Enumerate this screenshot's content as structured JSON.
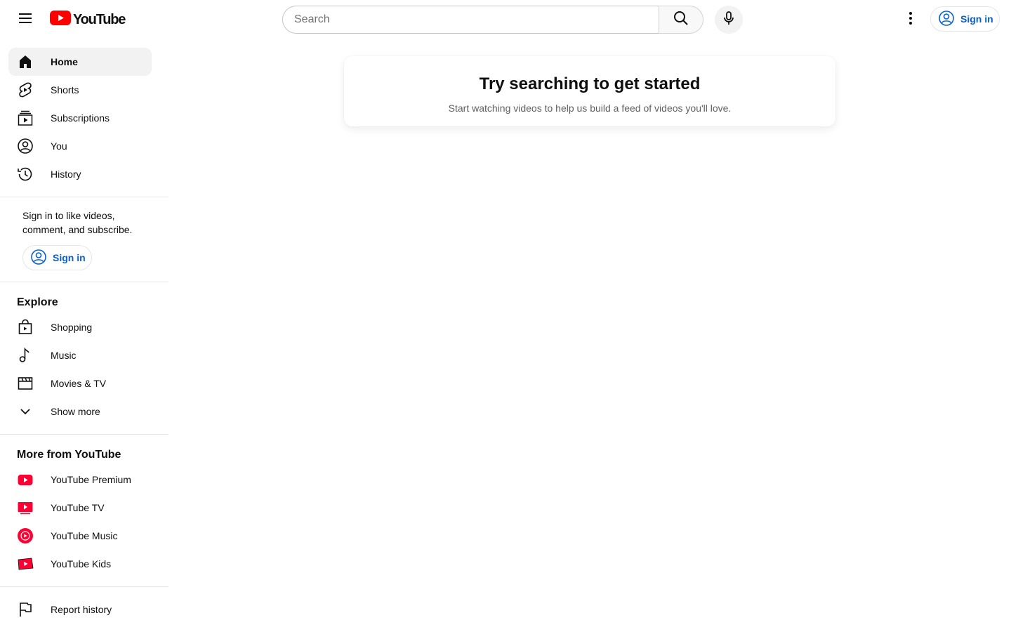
{
  "header": {
    "logo_text": "YouTube",
    "search_placeholder": "Search",
    "signin_label": "Sign in"
  },
  "sidebar": {
    "main_items": [
      {
        "label": "Home",
        "icon": "home-icon",
        "active": true
      },
      {
        "label": "Shorts",
        "icon": "shorts-icon"
      },
      {
        "label": "Subscriptions",
        "icon": "subscriptions-icon"
      },
      {
        "label": "You",
        "icon": "account-icon"
      },
      {
        "label": "History",
        "icon": "history-icon"
      }
    ],
    "signin_prompt": {
      "text": "Sign in to like videos, comment, and subscribe.",
      "button_label": "Sign in"
    },
    "explore": {
      "title": "Explore",
      "items": [
        {
          "label": "Shopping",
          "icon": "shopping-bag-icon"
        },
        {
          "label": "Music",
          "icon": "music-note-icon"
        },
        {
          "label": "Movies & TV",
          "icon": "clapperboard-icon"
        },
        {
          "label": "Show more",
          "icon": "chevron-down-icon"
        }
      ]
    },
    "more_from": {
      "title": "More from YouTube",
      "items": [
        {
          "label": "YouTube Premium",
          "icon": "youtube-premium-icon"
        },
        {
          "label": "YouTube TV",
          "icon": "youtube-tv-icon"
        },
        {
          "label": "YouTube Music",
          "icon": "youtube-music-icon"
        },
        {
          "label": "YouTube Kids",
          "icon": "youtube-kids-icon"
        }
      ]
    },
    "footer_items": [
      {
        "label": "Report history",
        "icon": "flag-icon"
      }
    ]
  },
  "main": {
    "empty_title": "Try searching to get started",
    "empty_subtitle": "Start watching videos to help us build a feed of videos you'll love."
  },
  "colors": {
    "brand_red": "#ff0000",
    "link_blue": "#065fd4",
    "active_bg": "#f2f2f2"
  }
}
